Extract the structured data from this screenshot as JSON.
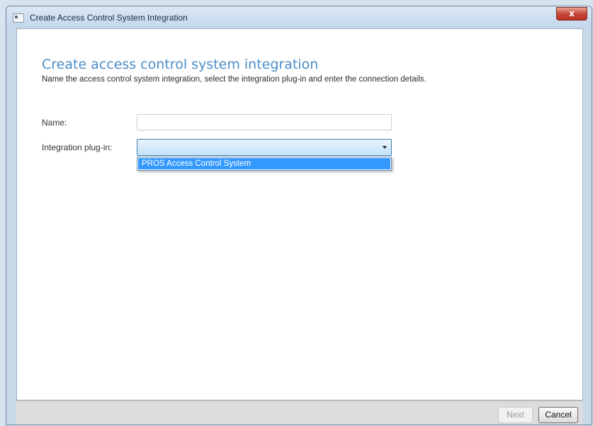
{
  "window": {
    "title": "Create Access Control System Integration",
    "close_label": "x"
  },
  "page": {
    "heading": "Create access control system integration",
    "description": "Name the access control system integration, select the integration plug-in and enter the connection details."
  },
  "form": {
    "name_label": "Name:",
    "name_value": "",
    "plugin_label": "Integration plug-in:",
    "plugin_selected": "",
    "plugin_options": [
      "PROS Access Control System"
    ],
    "highlighted_option": "PROS Access Control System"
  },
  "footer": {
    "next_label": "Next",
    "cancel_label": "Cancel"
  },
  "colors": {
    "heading": "#4c8dc8",
    "highlight": "#3399ff",
    "footer_bg": "#dcdcdc"
  }
}
